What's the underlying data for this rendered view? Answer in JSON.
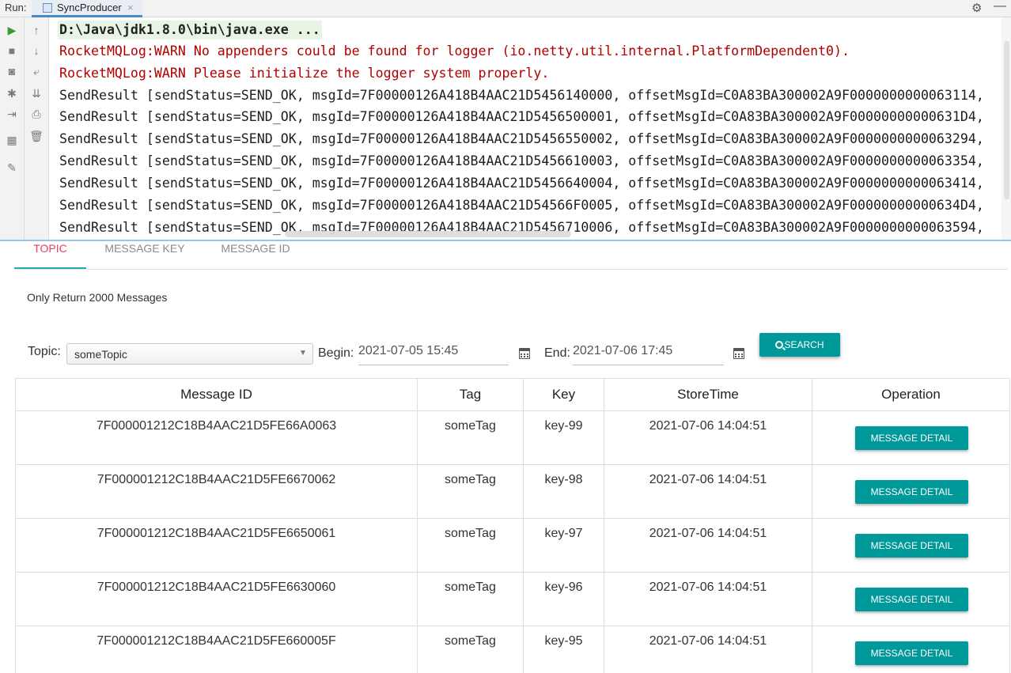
{
  "ide": {
    "run_label": "Run:",
    "tab_title": "SyncProducer",
    "close_glyph": "×",
    "gear_glyph": "⚙",
    "minimize_glyph": "—",
    "console_lines": [
      "D:\\Java\\jdk1.8.0\\bin\\java.exe ...",
      "RocketMQLog:WARN No appenders could be found for logger (io.netty.util.internal.PlatformDependent0).",
      "RocketMQLog:WARN Please initialize the logger system properly.",
      "SendResult [sendStatus=SEND_OK, msgId=7F00000126A418B4AAC21D5456140000, offsetMsgId=C0A83BA300002A9F0000000000063114,",
      "SendResult [sendStatus=SEND_OK, msgId=7F00000126A418B4AAC21D5456500001, offsetMsgId=C0A83BA300002A9F00000000000631D4,",
      "SendResult [sendStatus=SEND_OK, msgId=7F00000126A418B4AAC21D5456550002, offsetMsgId=C0A83BA300002A9F0000000000063294,",
      "SendResult [sendStatus=SEND_OK, msgId=7F00000126A418B4AAC21D5456610003, offsetMsgId=C0A83BA300002A9F0000000000063354,",
      "SendResult [sendStatus=SEND_OK, msgId=7F00000126A418B4AAC21D5456640004, offsetMsgId=C0A83BA300002A9F0000000000063414,",
      "SendResult [sendStatus=SEND_OK, msgId=7F00000126A418B4AAC21D54566F0005, offsetMsgId=C0A83BA300002A9F00000000000634D4,",
      "SendResult [sendStatus=SEND_OK, msgId=7F00000126A418B4AAC21D5456710006, offsetMsgId=C0A83BA300002A9F0000000000063594,"
    ],
    "gutter_left_icons": [
      "run-icon",
      "stop-icon",
      "camera-icon",
      "settings-icon",
      "login-icon",
      "layout-icon",
      "pin-icon"
    ],
    "gutter_right_icons": [
      "arrow-up-icon",
      "arrow-down-icon",
      "soft-wrap-icon",
      "scroll-to-end-icon",
      "print-icon",
      "trash-icon"
    ],
    "colors": {
      "warn": "#b00000",
      "accent": "#009999",
      "tab_active": "#e0435e"
    }
  },
  "console_app": {
    "tabs": [
      {
        "label": "TOPIC",
        "active": true
      },
      {
        "label": "MESSAGE KEY",
        "active": false
      },
      {
        "label": "MESSAGE ID",
        "active": false
      }
    ],
    "note": "Only Return 2000 Messages",
    "filter": {
      "topic_label": "Topic:",
      "topic_value": "someTopic",
      "begin_label": "Begin:",
      "begin_value": "2021-07-05 15:45",
      "end_label": "End:",
      "end_value": "2021-07-06 17:45",
      "search_label": "SEARCH"
    },
    "table": {
      "columns": [
        "Message ID",
        "Tag",
        "Key",
        "StoreTime",
        "Operation"
      ],
      "rows": [
        {
          "id": "7F000001212C18B4AAC21D5FE66A0063",
          "tag": "someTag",
          "key": "key-99",
          "time": "2021-07-06 14:04:51",
          "action": "MESSAGE DETAIL"
        },
        {
          "id": "7F000001212C18B4AAC21D5FE6670062",
          "tag": "someTag",
          "key": "key-98",
          "time": "2021-07-06 14:04:51",
          "action": "MESSAGE DETAIL"
        },
        {
          "id": "7F000001212C18B4AAC21D5FE6650061",
          "tag": "someTag",
          "key": "key-97",
          "time": "2021-07-06 14:04:51",
          "action": "MESSAGE DETAIL"
        },
        {
          "id": "7F000001212C18B4AAC21D5FE6630060",
          "tag": "someTag",
          "key": "key-96",
          "time": "2021-07-06 14:04:51",
          "action": "MESSAGE DETAIL"
        },
        {
          "id": "7F000001212C18B4AAC21D5FE660005F",
          "tag": "someTag",
          "key": "key-95",
          "time": "2021-07-06 14:04:51",
          "action": "MESSAGE DETAIL"
        }
      ]
    }
  }
}
